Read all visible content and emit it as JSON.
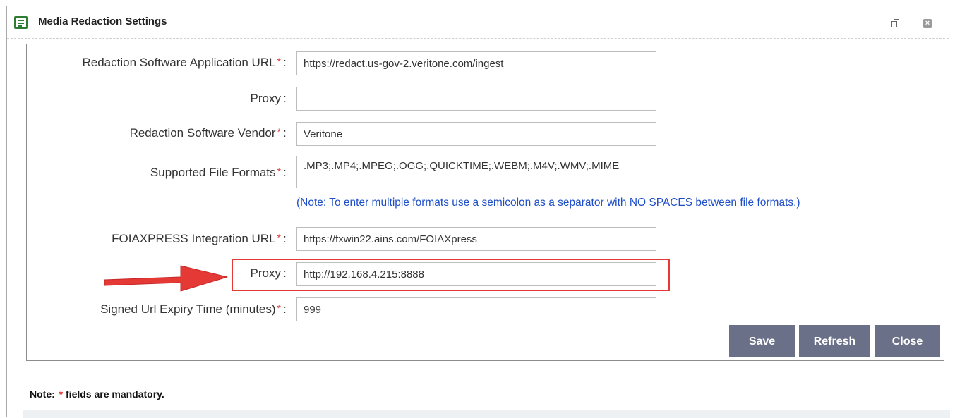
{
  "window": {
    "title": "Media Redaction Settings",
    "icon": "document-list-icon",
    "controls": [
      "restore-icon",
      "close-icon"
    ]
  },
  "form": {
    "fields": [
      {
        "label": "Redaction Software Application URL",
        "required": true,
        "value": "https://redact.us-gov-2.veritone.com/ingest"
      },
      {
        "label": "Proxy",
        "required": false,
        "value": ""
      },
      {
        "label": "Redaction Software Vendor",
        "required": true,
        "value": "Veritone"
      },
      {
        "label": "Supported File Formats",
        "required": true,
        "value": ".MP3;.MP4;.MPEG;.OGG;.QUICKTIME;.WEBM;.M4V;.WMV;.MIME"
      },
      {
        "label": "FOIAXPRESS Integration URL",
        "required": true,
        "value": "https://fxwin22.ains.com/FOIAXpress"
      },
      {
        "label": "Proxy",
        "required": false,
        "value": "http://192.168.4.215:8888"
      },
      {
        "label": "Signed Url Expiry Time (minutes)",
        "required": true,
        "value": "999"
      }
    ],
    "formats_note": "(Note: To enter multiple formats use a semicolon as a separator with NO SPACES between file formats.)",
    "colon": ":",
    "required_marker": "*"
  },
  "buttons": {
    "save": "Save",
    "refresh": "Refresh",
    "close": "Close"
  },
  "footer": {
    "note_prefix": "Note:",
    "note_suffix": "fields are mandatory."
  },
  "colors": {
    "required": "#e53935",
    "button": "#6b7089",
    "note_link": "#1e4ec8",
    "highlight": "#e53935"
  }
}
